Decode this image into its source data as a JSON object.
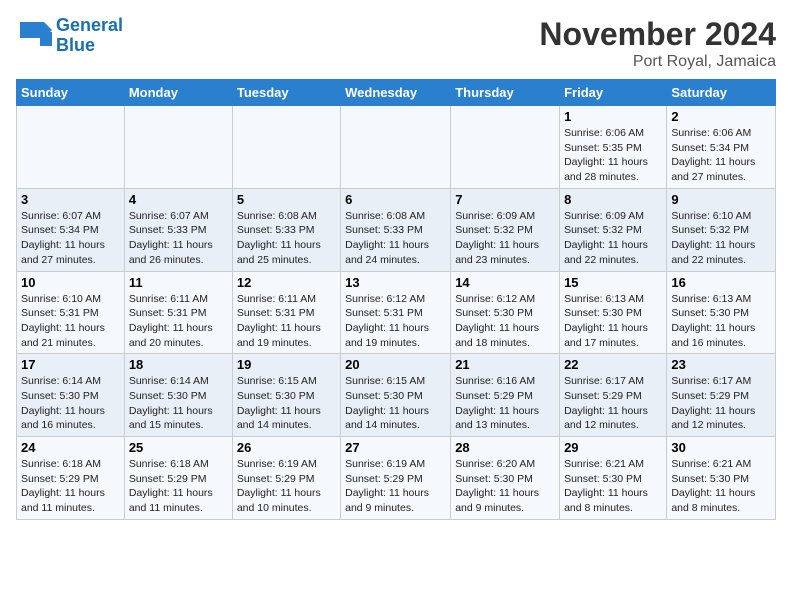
{
  "logo": {
    "line1": "General",
    "line2": "Blue"
  },
  "title": "November 2024",
  "location": "Port Royal, Jamaica",
  "days_header": [
    "Sunday",
    "Monday",
    "Tuesday",
    "Wednesday",
    "Thursday",
    "Friday",
    "Saturday"
  ],
  "weeks": [
    [
      {
        "day": "",
        "info": ""
      },
      {
        "day": "",
        "info": ""
      },
      {
        "day": "",
        "info": ""
      },
      {
        "day": "",
        "info": ""
      },
      {
        "day": "",
        "info": ""
      },
      {
        "day": "1",
        "info": "Sunrise: 6:06 AM\nSunset: 5:35 PM\nDaylight: 11 hours and 28 minutes."
      },
      {
        "day": "2",
        "info": "Sunrise: 6:06 AM\nSunset: 5:34 PM\nDaylight: 11 hours and 27 minutes."
      }
    ],
    [
      {
        "day": "3",
        "info": "Sunrise: 6:07 AM\nSunset: 5:34 PM\nDaylight: 11 hours and 27 minutes."
      },
      {
        "day": "4",
        "info": "Sunrise: 6:07 AM\nSunset: 5:33 PM\nDaylight: 11 hours and 26 minutes."
      },
      {
        "day": "5",
        "info": "Sunrise: 6:08 AM\nSunset: 5:33 PM\nDaylight: 11 hours and 25 minutes."
      },
      {
        "day": "6",
        "info": "Sunrise: 6:08 AM\nSunset: 5:33 PM\nDaylight: 11 hours and 24 minutes."
      },
      {
        "day": "7",
        "info": "Sunrise: 6:09 AM\nSunset: 5:32 PM\nDaylight: 11 hours and 23 minutes."
      },
      {
        "day": "8",
        "info": "Sunrise: 6:09 AM\nSunset: 5:32 PM\nDaylight: 11 hours and 22 minutes."
      },
      {
        "day": "9",
        "info": "Sunrise: 6:10 AM\nSunset: 5:32 PM\nDaylight: 11 hours and 22 minutes."
      }
    ],
    [
      {
        "day": "10",
        "info": "Sunrise: 6:10 AM\nSunset: 5:31 PM\nDaylight: 11 hours and 21 minutes."
      },
      {
        "day": "11",
        "info": "Sunrise: 6:11 AM\nSunset: 5:31 PM\nDaylight: 11 hours and 20 minutes."
      },
      {
        "day": "12",
        "info": "Sunrise: 6:11 AM\nSunset: 5:31 PM\nDaylight: 11 hours and 19 minutes."
      },
      {
        "day": "13",
        "info": "Sunrise: 6:12 AM\nSunset: 5:31 PM\nDaylight: 11 hours and 19 minutes."
      },
      {
        "day": "14",
        "info": "Sunrise: 6:12 AM\nSunset: 5:30 PM\nDaylight: 11 hours and 18 minutes."
      },
      {
        "day": "15",
        "info": "Sunrise: 6:13 AM\nSunset: 5:30 PM\nDaylight: 11 hours and 17 minutes."
      },
      {
        "day": "16",
        "info": "Sunrise: 6:13 AM\nSunset: 5:30 PM\nDaylight: 11 hours and 16 minutes."
      }
    ],
    [
      {
        "day": "17",
        "info": "Sunrise: 6:14 AM\nSunset: 5:30 PM\nDaylight: 11 hours and 16 minutes."
      },
      {
        "day": "18",
        "info": "Sunrise: 6:14 AM\nSunset: 5:30 PM\nDaylight: 11 hours and 15 minutes."
      },
      {
        "day": "19",
        "info": "Sunrise: 6:15 AM\nSunset: 5:30 PM\nDaylight: 11 hours and 14 minutes."
      },
      {
        "day": "20",
        "info": "Sunrise: 6:15 AM\nSunset: 5:30 PM\nDaylight: 11 hours and 14 minutes."
      },
      {
        "day": "21",
        "info": "Sunrise: 6:16 AM\nSunset: 5:29 PM\nDaylight: 11 hours and 13 minutes."
      },
      {
        "day": "22",
        "info": "Sunrise: 6:17 AM\nSunset: 5:29 PM\nDaylight: 11 hours and 12 minutes."
      },
      {
        "day": "23",
        "info": "Sunrise: 6:17 AM\nSunset: 5:29 PM\nDaylight: 11 hours and 12 minutes."
      }
    ],
    [
      {
        "day": "24",
        "info": "Sunrise: 6:18 AM\nSunset: 5:29 PM\nDaylight: 11 hours and 11 minutes."
      },
      {
        "day": "25",
        "info": "Sunrise: 6:18 AM\nSunset: 5:29 PM\nDaylight: 11 hours and 11 minutes."
      },
      {
        "day": "26",
        "info": "Sunrise: 6:19 AM\nSunset: 5:29 PM\nDaylight: 11 hours and 10 minutes."
      },
      {
        "day": "27",
        "info": "Sunrise: 6:19 AM\nSunset: 5:29 PM\nDaylight: 11 hours and 9 minutes."
      },
      {
        "day": "28",
        "info": "Sunrise: 6:20 AM\nSunset: 5:30 PM\nDaylight: 11 hours and 9 minutes."
      },
      {
        "day": "29",
        "info": "Sunrise: 6:21 AM\nSunset: 5:30 PM\nDaylight: 11 hours and 8 minutes."
      },
      {
        "day": "30",
        "info": "Sunrise: 6:21 AM\nSunset: 5:30 PM\nDaylight: 11 hours and 8 minutes."
      }
    ]
  ]
}
